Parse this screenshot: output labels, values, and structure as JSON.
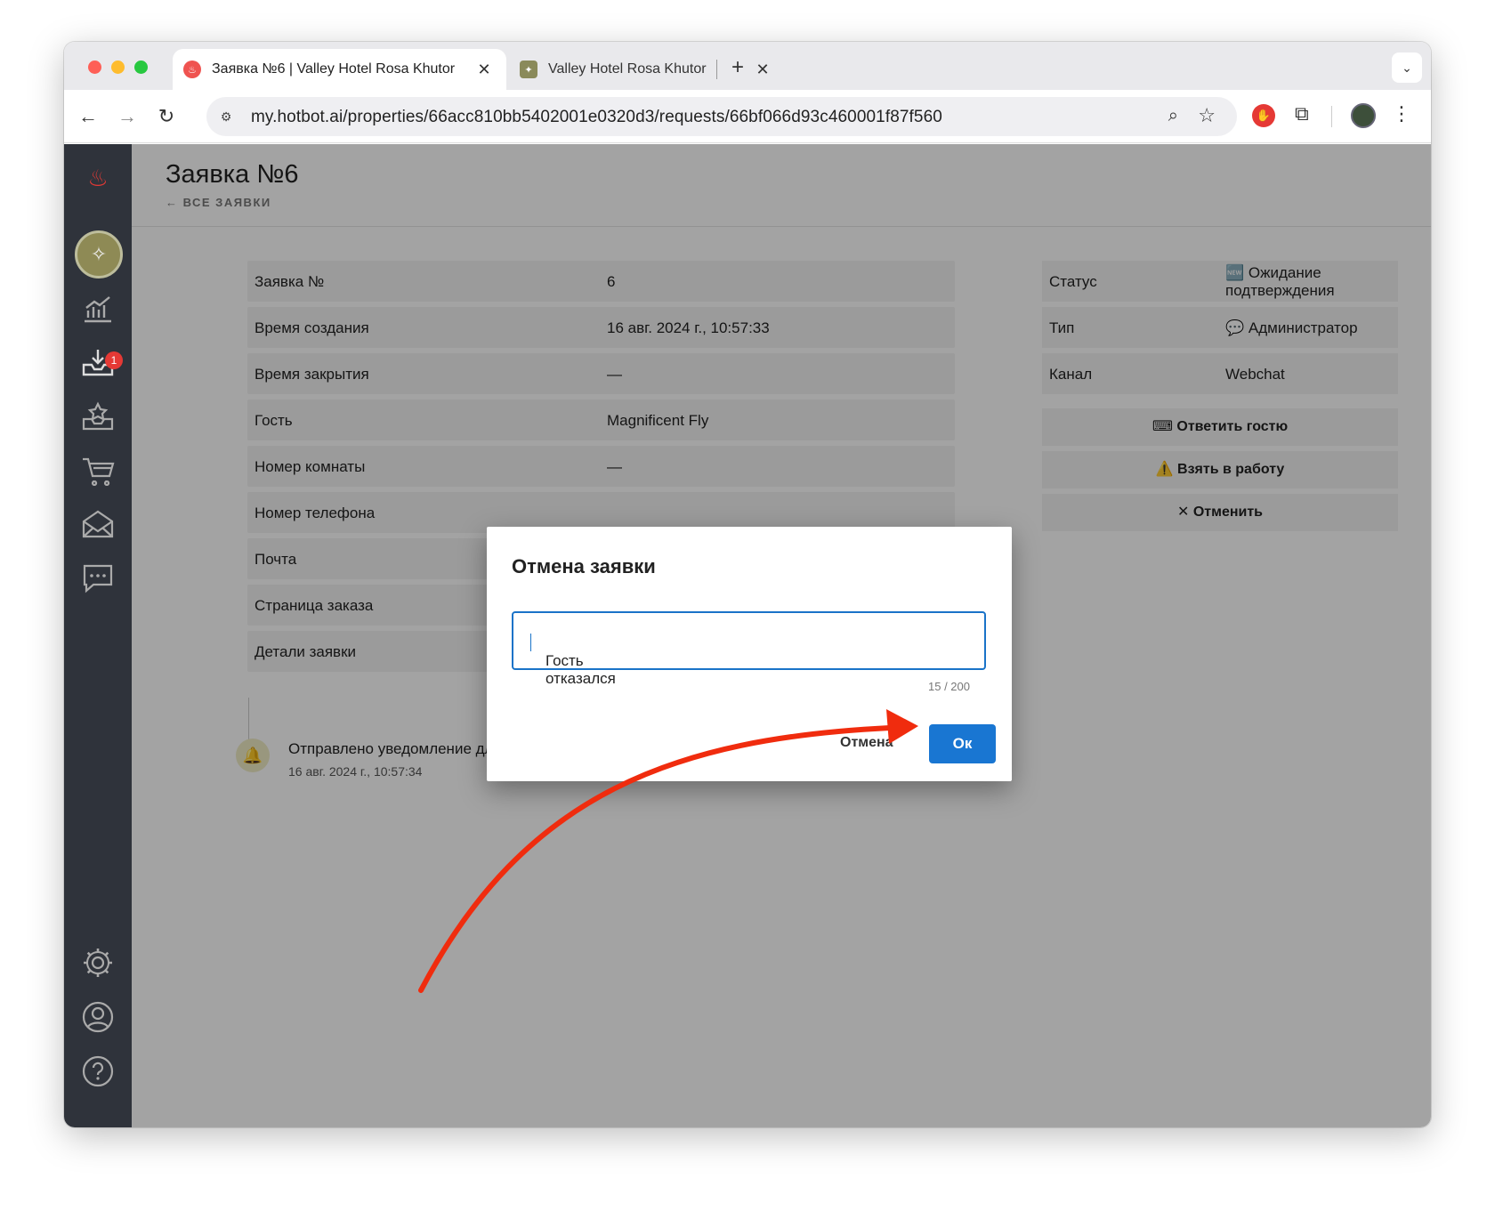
{
  "browser": {
    "tabs": [
      {
        "title": "Заявка №6 | Valley Hotel Rosa Khutor",
        "active": true
      },
      {
        "title": "Valley Hotel Rosa Khutor",
        "active": false
      }
    ],
    "url": "my.hotbot.ai/properties/66acc810bb5402001e0320d3/requests/66bf066d93c460001f87f560"
  },
  "sidebar": {
    "notification_badge": "1",
    "items": [
      "analytics-icon",
      "inbox-icon",
      "reviews-icon",
      "cart-icon",
      "mail-icon",
      "chat-icon",
      "settings-icon",
      "profile-icon",
      "help-icon"
    ]
  },
  "header": {
    "title": "Заявка №6",
    "back_link": "← ВСЕ ЗАЯВКИ"
  },
  "details": [
    {
      "label": "Заявка №",
      "value": "6"
    },
    {
      "label": "Время создания",
      "value": "16 авг. 2024 г., 10:57:33"
    },
    {
      "label": "Время закрытия",
      "value": "—"
    },
    {
      "label": "Гость",
      "value": "Magnificent Fly"
    },
    {
      "label": "Номер комнаты",
      "value": "—"
    },
    {
      "label": "Номер телефона",
      "value": ""
    },
    {
      "label": "Почта",
      "value": ""
    },
    {
      "label": "Страница заказа",
      "value": ""
    },
    {
      "label": "Детали заявки",
      "value": ""
    }
  ],
  "side_info": [
    {
      "label": "Статус",
      "value": "🆕 Ожидание подтверждения"
    },
    {
      "label": "Тип",
      "value": "💬 Администратор"
    },
    {
      "label": "Канал",
      "value": "Webchat"
    }
  ],
  "actions": {
    "reply": "⌨ Ответить гостю",
    "take": "⚠️ Взять в работу",
    "cancel": "✕ Отменить"
  },
  "timeline": {
    "text": "Отправлено уведомление дл",
    "time": "16 авг. 2024 г., 10:57:34"
  },
  "modal": {
    "title": "Отмена заявки",
    "input_value": "Гость отказался",
    "counter": "15 / 200",
    "cancel_label": "Отмена",
    "ok_label": "Ок"
  },
  "colors": {
    "primary": "#1976d2",
    "sidebar": "#2f333b",
    "annotation_arrow": "#f02c0e"
  }
}
